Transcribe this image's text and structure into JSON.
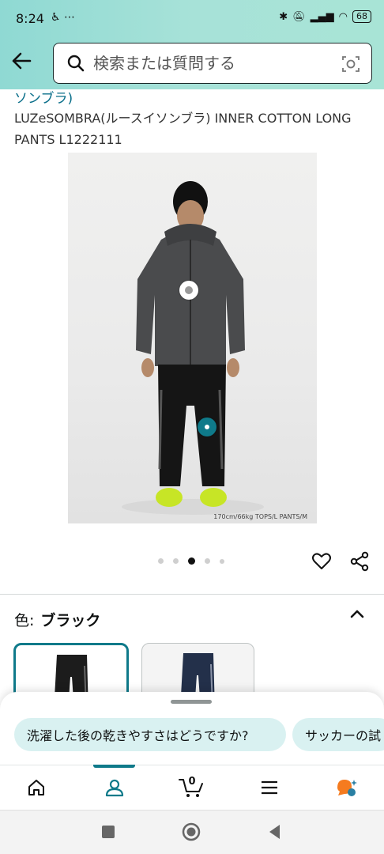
{
  "status_bar": {
    "time": "8:24",
    "battery": "68"
  },
  "search": {
    "placeholder": "検索または質問する"
  },
  "product": {
    "breadcrumb_tail": "ソンブラ)",
    "title": "LUZeSOMBRA(ルースイソンブラ) INNER COTTON LONG PANTS L1222111",
    "image_caption": "170cm/66kg TOPS/L PANTS/M",
    "carousel_total": 5,
    "carousel_active": 3
  },
  "variation": {
    "label": "色:",
    "value": "ブラック",
    "swatches": [
      {
        "name": "ブラック",
        "color": "#1c1c1c",
        "selected": true
      },
      {
        "name": "ネイビー",
        "color": "#23304a",
        "selected": false
      }
    ]
  },
  "suggestions": {
    "chips": [
      "洗濯した後の乾きやすさはどうですか?",
      "サッカーの試"
    ]
  },
  "bottom_nav": {
    "cart_count": "0",
    "items": [
      "home-icon",
      "account-icon",
      "cart-icon",
      "menu-icon",
      "rufus-icon"
    ]
  },
  "colors": {
    "accent": "#0f7a8a",
    "header_gradient_start": "#8fd9d3",
    "header_gradient_end": "#a8e4d6",
    "chip_bg": "#d9f1f1"
  }
}
